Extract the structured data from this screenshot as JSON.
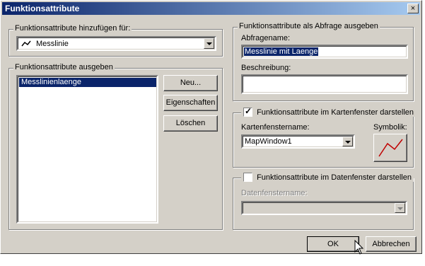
{
  "window": {
    "title": "Funktionsattribute",
    "close_glyph": "×"
  },
  "left_top_group": {
    "legend": "Funktionsattribute hinzufügen für:",
    "combo_value": "Messlinie",
    "combo_icon": "line-icon"
  },
  "left_bottom_group": {
    "legend": "Funktionsattribute ausgeben",
    "list_items": [
      "Messlinienlaenge"
    ],
    "buttons": {
      "new": "Neu...",
      "properties": "Eigenschaften",
      "delete": "Löschen"
    }
  },
  "query_group": {
    "legend": "Funktionsattribute als Abfrage ausgeben",
    "name_label": "Abfragename:",
    "name_value": "Messlinie mit Laenge",
    "desc_label": "Beschreibung:",
    "desc_value": ""
  },
  "map_group": {
    "checkbox_label": "Funktionsattribute im Kartenfenster darstellen",
    "checked": true,
    "window_label": "Kartenfenstername:",
    "window_value": "MapWindow1",
    "symbol_label": "Symbolik:"
  },
  "data_group": {
    "checkbox_label": "Funktionsattribute im Datenfenster darstellen",
    "checked": false,
    "window_label": "Datenfenstername:",
    "window_value": ""
  },
  "footer": {
    "ok": "OK",
    "cancel": "Abbrechen"
  },
  "colors": {
    "title_start": "#0a246a",
    "title_end": "#a6caf0",
    "selection": "#0a246a",
    "symbol_line": "#c00000"
  }
}
